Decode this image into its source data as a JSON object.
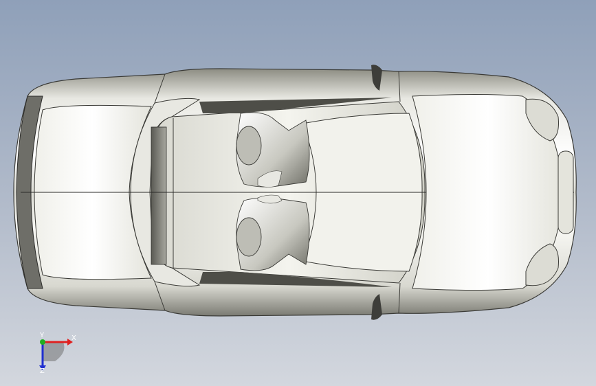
{
  "viewport": {
    "model": "car-body-top-view"
  },
  "triad": {
    "x_label": "X",
    "y_label": "Y",
    "z_label": "Z",
    "colors": {
      "x": "#e02020",
      "y": "#20b020",
      "z": "#2030d0"
    }
  }
}
